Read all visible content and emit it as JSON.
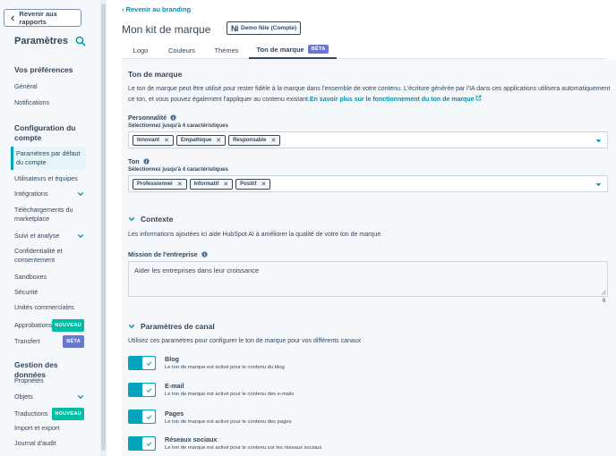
{
  "sidebar": {
    "back_label": "Revenir aux rapports",
    "title": "Paramètres",
    "sections": {
      "prefs": "Vos préférences",
      "account": "Configuration du compte",
      "data": "Gestion des données"
    },
    "items": {
      "general": "Général",
      "notifications": "Notifications",
      "defaults": "Paramètres par défaut du compte",
      "users": "Utilisateurs et équipes",
      "integrations": "Intégrations",
      "marketplace": "Téléchargements du marketplace",
      "tracking": "Suivi et analyse",
      "privacy": "Confidentialité et consentement",
      "sandboxes": "Sandboxes",
      "security": "Sécurité",
      "business_units": "Unités commerciales",
      "approvals": "Approbations",
      "transfer": "Transfert",
      "properties": "Propriétés",
      "objects": "Objets",
      "translations": "Traductions",
      "import_export": "Import et export",
      "audit_log": "Journal d'audit"
    },
    "badges": {
      "new": "NOUVEAU",
      "beta": "BÊTA"
    }
  },
  "header": {
    "back_link": "Revenir au branding",
    "title": "Mon kit de marque",
    "company_logo": "Ni",
    "company_label": "Demo Nile (Compte)"
  },
  "tabs": [
    {
      "label": "Logo"
    },
    {
      "label": "Couleurs"
    },
    {
      "label": "Thèmes"
    },
    {
      "label": "Ton de marque",
      "badge": "BÊTA"
    }
  ],
  "brand_voice": {
    "title": "Ton de marque",
    "description": "Le ton de marque peut être utilisé pour rester fidèle à la marque dans l'ensemble de votre contenu. L'écriture générée par l'IA dans ces applications utilisera automatiquement ce ton, et vous pouvez également l'appliquer au contenu existant.",
    "learn_more": "En savoir plus sur le fonctionnement du ton de marque",
    "personality": {
      "label": "Personnalité",
      "hint": "Sélectionnez jusqu'à 4 caractéristiques",
      "chips": [
        "Innovant",
        "Empathique",
        "Responsable"
      ]
    },
    "tone": {
      "label": "Ton",
      "hint": "Sélectionnez jusqu'à 4 caractéristiques",
      "chips": [
        "Professionnel",
        "Informatif",
        "Positif"
      ]
    }
  },
  "context": {
    "title": "Contexte",
    "description": "Les informations ajoutées ici aide HubSpot AI à améliorer la qualité de votre ton de marque.",
    "mission_label": "Mission de l'entreprise",
    "mission_value": "Aider les entreprises dans leur croissance",
    "counter": "6"
  },
  "channels": {
    "title": "Paramètres de canal",
    "description": "Utilisez ces paramètres pour configurer le ton de marque pour vos différents canaux",
    "items": [
      {
        "title": "Blog",
        "desc": "Le ton de marque est activé pour le contenu du blog",
        "enabled": true
      },
      {
        "title": "E-mail",
        "desc": "Le ton de marque est activé pour le contenu des e-mails",
        "enabled": true
      },
      {
        "title": "Pages",
        "desc": "Le ton de marque est activé pour le contenu des pages",
        "enabled": true
      },
      {
        "title": "Réseaux sociaux",
        "desc": "Le ton de marque est activé pour le contenu sur les réseaux sociaux",
        "enabled": true
      }
    ]
  },
  "colors": {
    "accent": "#00a4bd",
    "link": "#0091ae",
    "text": "#33475b",
    "new_badge": "#00bda5",
    "beta_badge": "#6a78d1"
  }
}
